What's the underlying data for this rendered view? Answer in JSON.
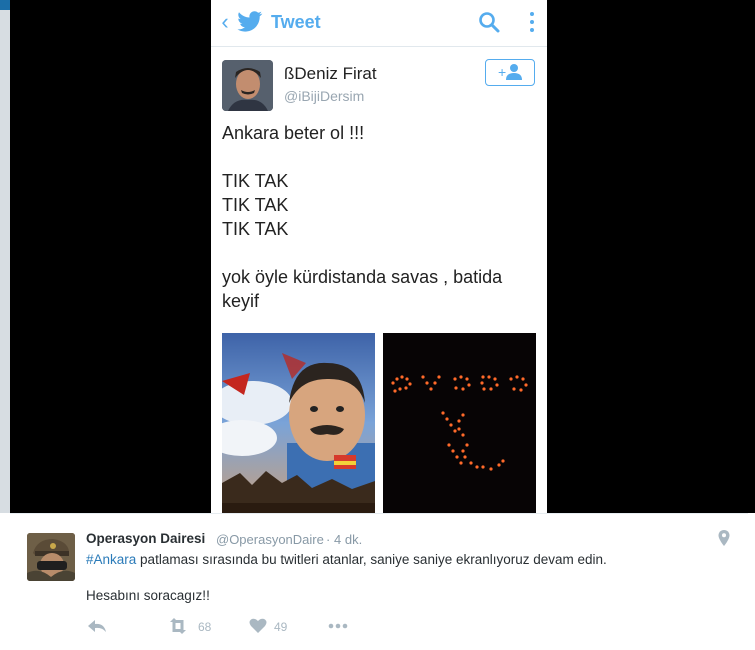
{
  "embedded_screenshot": {
    "header": {
      "title": "Tweet"
    },
    "author": {
      "name": "ßDeniz Firat",
      "handle": "@iBijiDersim"
    },
    "tweet_lines": [
      "Ankara beter ol !!!",
      "",
      "TIK TAK",
      "TIK TAK",
      "TIK TAK",
      "",
      "yok öyle kürdistanda savas , batida",
      "keyif"
    ],
    "images": [
      "portrait-illustration",
      "candle-lights"
    ]
  },
  "tweet": {
    "author_name": "Operasyon Dairesi",
    "author_handle": "@OperasyonDaire",
    "separator": "·",
    "time": "4 dk.",
    "hashtag": "#Ankara",
    "text_line1": " patlaması sırasında bu twitleri atanlar, saniye saniye ekranlıyoruz devam edin.",
    "text_line2": "Hesabını soracagız!!",
    "retweet_count": "68",
    "like_count": "49"
  },
  "colors": {
    "twitter_blue": "#55acee",
    "link": "#2b7bb9",
    "muted": "#8899a6",
    "icon_gray": "#aab8c2"
  }
}
